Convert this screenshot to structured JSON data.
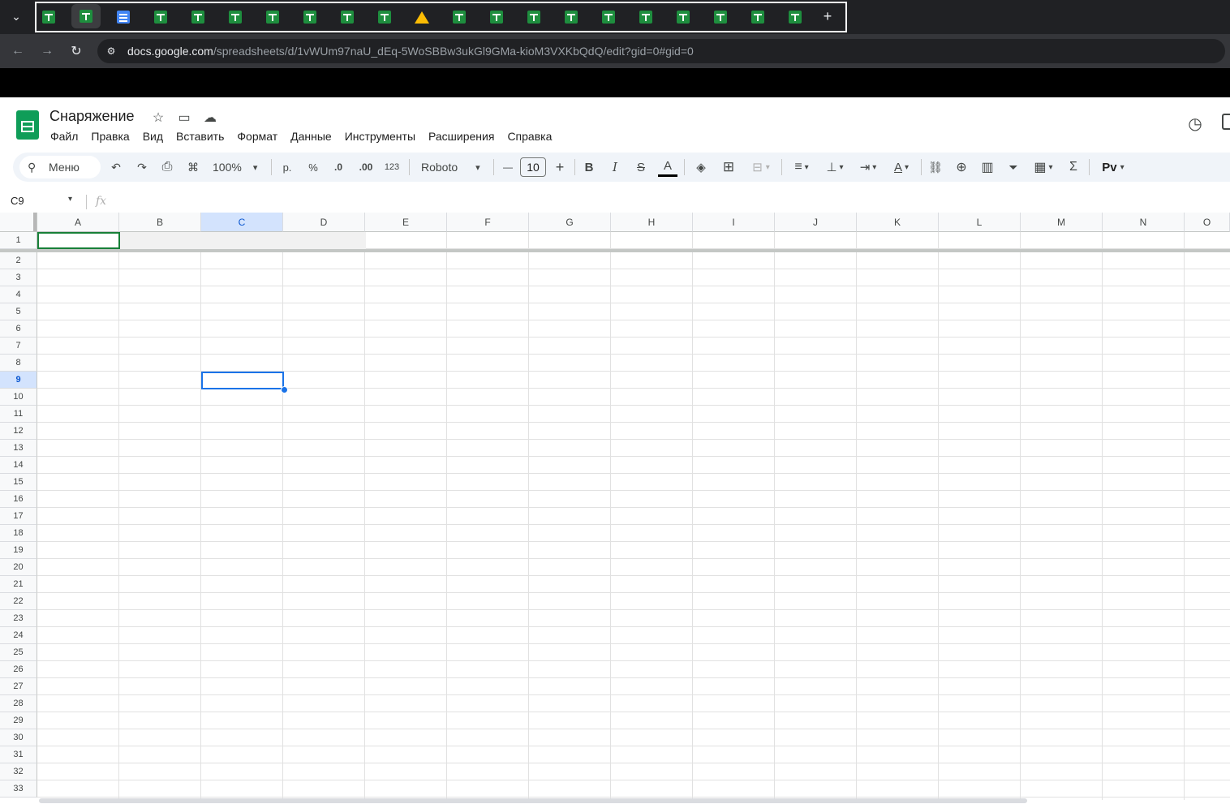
{
  "browser": {
    "tabs": [
      {
        "type": "sheets",
        "active": false
      },
      {
        "type": "sheets",
        "active": true
      },
      {
        "type": "docs",
        "active": false
      },
      {
        "type": "sheets",
        "active": false
      },
      {
        "type": "sheets",
        "active": false
      },
      {
        "type": "sheets",
        "active": false
      },
      {
        "type": "sheets",
        "active": false
      },
      {
        "type": "sheets",
        "active": false
      },
      {
        "type": "sheets",
        "active": false
      },
      {
        "type": "sheets",
        "active": false
      },
      {
        "type": "drive",
        "active": false
      },
      {
        "type": "sheets",
        "active": false
      },
      {
        "type": "sheets",
        "active": false
      },
      {
        "type": "sheets",
        "active": false
      },
      {
        "type": "sheets",
        "active": false
      },
      {
        "type": "sheets",
        "active": false
      },
      {
        "type": "sheets",
        "active": false
      },
      {
        "type": "sheets",
        "active": false
      },
      {
        "type": "sheets",
        "active": false
      },
      {
        "type": "sheets",
        "active": false
      },
      {
        "type": "sheets",
        "active": false
      }
    ],
    "tab_menu_glyph": "⌄",
    "new_tab_glyph": "+",
    "url_host": "docs.google.com",
    "url_path": "/spreadsheets/d/1vWUm97naU_dEq-5WoSBBw3ukGl9GMa-kioM3VXKbQdQ/edit?gid=0#gid=0",
    "back_glyph": "←",
    "forward_glyph": "→",
    "reload_glyph": "↻",
    "site_info_glyph": "⚙",
    "colors": {
      "chrome_dark": "#202124",
      "sheets_green": "#1e8e3e",
      "docs_blue": "#4285f4",
      "drive_yellow": "#fbbc04"
    }
  },
  "sheets": {
    "title": "Снаряжение",
    "star_glyph": "☆",
    "move_glyph": "▭",
    "cloud_glyph": "☁",
    "history_glyph": "◷",
    "menu": [
      "Файл",
      "Правка",
      "Вид",
      "Вставить",
      "Формат",
      "Данные",
      "Инструменты",
      "Расширения",
      "Справка"
    ],
    "toolbar": {
      "search_label": "Меню",
      "search_glyph": "⚲",
      "undo": "↶",
      "redo": "↷",
      "print": "⎙",
      "paint_format": "⌘",
      "zoom": "100%",
      "currency": "р.",
      "percent": "%",
      "dec_decrease": ".0",
      "dec_increase": ".00",
      "number_format": "123",
      "font": "Roboto",
      "size_minus": "—",
      "font_size": "10",
      "size_plus": "+",
      "bold": "B",
      "italic": "I",
      "strike": "S",
      "text_color": "A",
      "fill_color": "◈",
      "borders": "⊞",
      "merge": "⊟",
      "align": "≡",
      "valign": "⊥",
      "wrap": "⇥",
      "rotate": "A",
      "link": "⛓",
      "comment": "⊕",
      "chart": "▥",
      "filter": "⏷",
      "table": "▦",
      "functions": "Σ",
      "input_tools": "Pv",
      "dropdown_glyph": "▾"
    },
    "name_box": "C9",
    "fx_label": "fx",
    "columns": [
      "A",
      "B",
      "C",
      "D",
      "E",
      "F",
      "G",
      "H",
      "I",
      "J",
      "K",
      "L",
      "M",
      "N",
      "O"
    ],
    "rows": [
      "1",
      "2",
      "3",
      "4",
      "5",
      "6",
      "7",
      "8",
      "9",
      "10",
      "11",
      "12",
      "13",
      "14",
      "15",
      "16",
      "17",
      "18",
      "19",
      "20",
      "21",
      "22",
      "23",
      "24",
      "25",
      "26",
      "27",
      "28",
      "29",
      "30",
      "31",
      "32",
      "33"
    ],
    "selected_column": "C",
    "selected_row": "9",
    "colors": {
      "selection_blue": "#1a73e8",
      "header_selected": "#d3e3fd",
      "accent_green": "#188038"
    }
  }
}
